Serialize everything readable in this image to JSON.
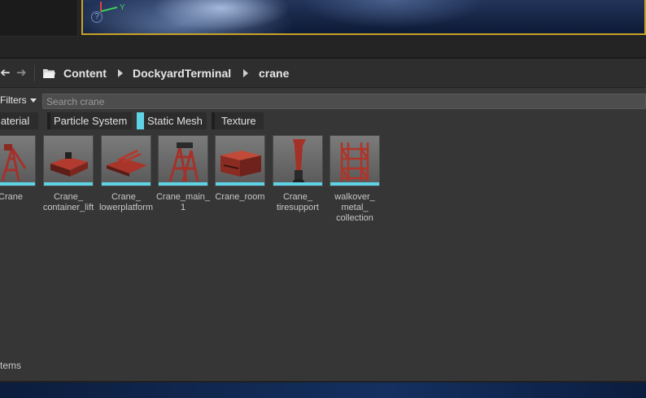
{
  "viewport": {
    "axis_label": "Y",
    "help_glyph": "?",
    "icons": [
      "axis-gizmo-icon",
      "help-icon"
    ],
    "highlight_color": "#c9a227"
  },
  "path_bar": {
    "back_icon": "arrow-left-icon",
    "forward_icon": "arrow-right-icon",
    "folder_icon": "folder-icon",
    "crumbs": [
      "Content",
      "DockyardTerminal",
      "crane"
    ]
  },
  "filters": {
    "label": "Filters",
    "search_placeholder": "Search crane"
  },
  "filter_chips": [
    {
      "label": "Material"
    },
    {
      "label": "Particle System"
    },
    {
      "label": "Static Mesh",
      "active": true,
      "color": "#5fd3e6"
    },
    {
      "label": "Texture"
    }
  ],
  "assets": [
    {
      "label": "Crane",
      "icon": "crane-mesh-icon"
    },
    {
      "label": "Crane_\ncontainer_lift",
      "icon": "container-lift-mesh-icon"
    },
    {
      "label": "Crane_\nlowerplatform",
      "icon": "lower-platform-mesh-icon"
    },
    {
      "label": "Crane_main_\n1",
      "icon": "crane-main-mesh-icon"
    },
    {
      "label": "Crane_room",
      "icon": "room-mesh-icon"
    },
    {
      "label": "Crane_\ntiresupport",
      "icon": "tire-support-mesh-icon"
    },
    {
      "label": "walkover_\nmetal_\ncollection",
      "icon": "walkover-mesh-icon"
    }
  ],
  "status": {
    "items_text": "tems"
  }
}
